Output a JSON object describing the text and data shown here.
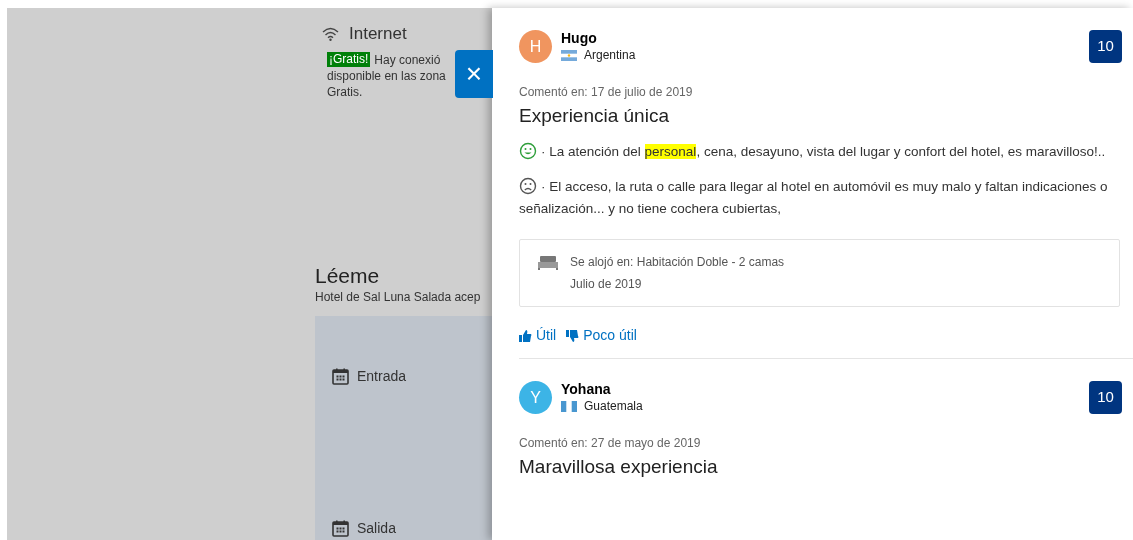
{
  "background": {
    "internet": {
      "title": "Internet",
      "badge": "¡Gratis!",
      "lines": [
        "Hay conexió",
        "disponible en las zona",
        "Gratis."
      ]
    },
    "readme": {
      "title": "Léeme",
      "text": "Hotel de Sal Luna Salada acep"
    },
    "dates": [
      {
        "label": "Entrada"
      },
      {
        "label": "Salida"
      }
    ]
  },
  "close_button": {
    "label": "×"
  },
  "reviews": [
    {
      "initial": "H",
      "color": "#f0955f",
      "name": "Hugo",
      "country": "Argentina",
      "score": "10",
      "date": "Comentó en: 17 de julio de 2019",
      "title": "Experiencia única",
      "positive": [
        {
          "text": "· La atención del ",
          "highlighted": false
        },
        {
          "text": "personal",
          "highlighted": true
        },
        {
          "text": ", cena, desayuno, vista del lugar y confort del hotel, es maravilloso!..",
          "highlighted": false
        }
      ],
      "negative": "· El acceso, la ruta o calle para llegar al hotel en automóvil es muy malo y faltan indicaciones o señalización... y no tiene cochera cubiertas,",
      "stay": {
        "room": "Se alojó en: Habitación Doble - 2 camas",
        "month": "Julio de 2019"
      },
      "helpful": "Útil",
      "not_helpful": "Poco útil"
    },
    {
      "initial": "Y",
      "color": "#3cb4e6",
      "name": "Yohana",
      "country": "Guatemala",
      "score": "10",
      "date": "Comentó en: 27 de mayo de 2019",
      "title": "Maravillosa experiencia"
    }
  ]
}
